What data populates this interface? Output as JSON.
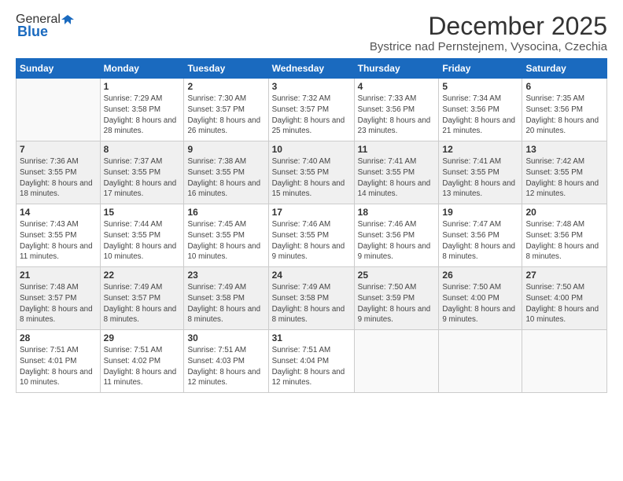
{
  "logo": {
    "general": "General",
    "blue": "Blue"
  },
  "header": {
    "title": "December 2025",
    "subtitle": "Bystrice nad Pernstejnem, Vysocina, Czechia"
  },
  "weekdays": [
    "Sunday",
    "Monday",
    "Tuesday",
    "Wednesday",
    "Thursday",
    "Friday",
    "Saturday"
  ],
  "weeks": [
    [
      {
        "day": "",
        "sunrise": "",
        "sunset": "",
        "daylight": ""
      },
      {
        "day": "1",
        "sunrise": "Sunrise: 7:29 AM",
        "sunset": "Sunset: 3:58 PM",
        "daylight": "Daylight: 8 hours and 28 minutes."
      },
      {
        "day": "2",
        "sunrise": "Sunrise: 7:30 AM",
        "sunset": "Sunset: 3:57 PM",
        "daylight": "Daylight: 8 hours and 26 minutes."
      },
      {
        "day": "3",
        "sunrise": "Sunrise: 7:32 AM",
        "sunset": "Sunset: 3:57 PM",
        "daylight": "Daylight: 8 hours and 25 minutes."
      },
      {
        "day": "4",
        "sunrise": "Sunrise: 7:33 AM",
        "sunset": "Sunset: 3:56 PM",
        "daylight": "Daylight: 8 hours and 23 minutes."
      },
      {
        "day": "5",
        "sunrise": "Sunrise: 7:34 AM",
        "sunset": "Sunset: 3:56 PM",
        "daylight": "Daylight: 8 hours and 21 minutes."
      },
      {
        "day": "6",
        "sunrise": "Sunrise: 7:35 AM",
        "sunset": "Sunset: 3:56 PM",
        "daylight": "Daylight: 8 hours and 20 minutes."
      }
    ],
    [
      {
        "day": "7",
        "sunrise": "Sunrise: 7:36 AM",
        "sunset": "Sunset: 3:55 PM",
        "daylight": "Daylight: 8 hours and 18 minutes."
      },
      {
        "day": "8",
        "sunrise": "Sunrise: 7:37 AM",
        "sunset": "Sunset: 3:55 PM",
        "daylight": "Daylight: 8 hours and 17 minutes."
      },
      {
        "day": "9",
        "sunrise": "Sunrise: 7:38 AM",
        "sunset": "Sunset: 3:55 PM",
        "daylight": "Daylight: 8 hours and 16 minutes."
      },
      {
        "day": "10",
        "sunrise": "Sunrise: 7:40 AM",
        "sunset": "Sunset: 3:55 PM",
        "daylight": "Daylight: 8 hours and 15 minutes."
      },
      {
        "day": "11",
        "sunrise": "Sunrise: 7:41 AM",
        "sunset": "Sunset: 3:55 PM",
        "daylight": "Daylight: 8 hours and 14 minutes."
      },
      {
        "day": "12",
        "sunrise": "Sunrise: 7:41 AM",
        "sunset": "Sunset: 3:55 PM",
        "daylight": "Daylight: 8 hours and 13 minutes."
      },
      {
        "day": "13",
        "sunrise": "Sunrise: 7:42 AM",
        "sunset": "Sunset: 3:55 PM",
        "daylight": "Daylight: 8 hours and 12 minutes."
      }
    ],
    [
      {
        "day": "14",
        "sunrise": "Sunrise: 7:43 AM",
        "sunset": "Sunset: 3:55 PM",
        "daylight": "Daylight: 8 hours and 11 minutes."
      },
      {
        "day": "15",
        "sunrise": "Sunrise: 7:44 AM",
        "sunset": "Sunset: 3:55 PM",
        "daylight": "Daylight: 8 hours and 10 minutes."
      },
      {
        "day": "16",
        "sunrise": "Sunrise: 7:45 AM",
        "sunset": "Sunset: 3:55 PM",
        "daylight": "Daylight: 8 hours and 10 minutes."
      },
      {
        "day": "17",
        "sunrise": "Sunrise: 7:46 AM",
        "sunset": "Sunset: 3:55 PM",
        "daylight": "Daylight: 8 hours and 9 minutes."
      },
      {
        "day": "18",
        "sunrise": "Sunrise: 7:46 AM",
        "sunset": "Sunset: 3:56 PM",
        "daylight": "Daylight: 8 hours and 9 minutes."
      },
      {
        "day": "19",
        "sunrise": "Sunrise: 7:47 AM",
        "sunset": "Sunset: 3:56 PM",
        "daylight": "Daylight: 8 hours and 8 minutes."
      },
      {
        "day": "20",
        "sunrise": "Sunrise: 7:48 AM",
        "sunset": "Sunset: 3:56 PM",
        "daylight": "Daylight: 8 hours and 8 minutes."
      }
    ],
    [
      {
        "day": "21",
        "sunrise": "Sunrise: 7:48 AM",
        "sunset": "Sunset: 3:57 PM",
        "daylight": "Daylight: 8 hours and 8 minutes."
      },
      {
        "day": "22",
        "sunrise": "Sunrise: 7:49 AM",
        "sunset": "Sunset: 3:57 PM",
        "daylight": "Daylight: 8 hours and 8 minutes."
      },
      {
        "day": "23",
        "sunrise": "Sunrise: 7:49 AM",
        "sunset": "Sunset: 3:58 PM",
        "daylight": "Daylight: 8 hours and 8 minutes."
      },
      {
        "day": "24",
        "sunrise": "Sunrise: 7:49 AM",
        "sunset": "Sunset: 3:58 PM",
        "daylight": "Daylight: 8 hours and 8 minutes."
      },
      {
        "day": "25",
        "sunrise": "Sunrise: 7:50 AM",
        "sunset": "Sunset: 3:59 PM",
        "daylight": "Daylight: 8 hours and 9 minutes."
      },
      {
        "day": "26",
        "sunrise": "Sunrise: 7:50 AM",
        "sunset": "Sunset: 4:00 PM",
        "daylight": "Daylight: 8 hours and 9 minutes."
      },
      {
        "day": "27",
        "sunrise": "Sunrise: 7:50 AM",
        "sunset": "Sunset: 4:00 PM",
        "daylight": "Daylight: 8 hours and 10 minutes."
      }
    ],
    [
      {
        "day": "28",
        "sunrise": "Sunrise: 7:51 AM",
        "sunset": "Sunset: 4:01 PM",
        "daylight": "Daylight: 8 hours and 10 minutes."
      },
      {
        "day": "29",
        "sunrise": "Sunrise: 7:51 AM",
        "sunset": "Sunset: 4:02 PM",
        "daylight": "Daylight: 8 hours and 11 minutes."
      },
      {
        "day": "30",
        "sunrise": "Sunrise: 7:51 AM",
        "sunset": "Sunset: 4:03 PM",
        "daylight": "Daylight: 8 hours and 12 minutes."
      },
      {
        "day": "31",
        "sunrise": "Sunrise: 7:51 AM",
        "sunset": "Sunset: 4:04 PM",
        "daylight": "Daylight: 8 hours and 12 minutes."
      },
      {
        "day": "",
        "sunrise": "",
        "sunset": "",
        "daylight": ""
      },
      {
        "day": "",
        "sunrise": "",
        "sunset": "",
        "daylight": ""
      },
      {
        "day": "",
        "sunrise": "",
        "sunset": "",
        "daylight": ""
      }
    ]
  ]
}
